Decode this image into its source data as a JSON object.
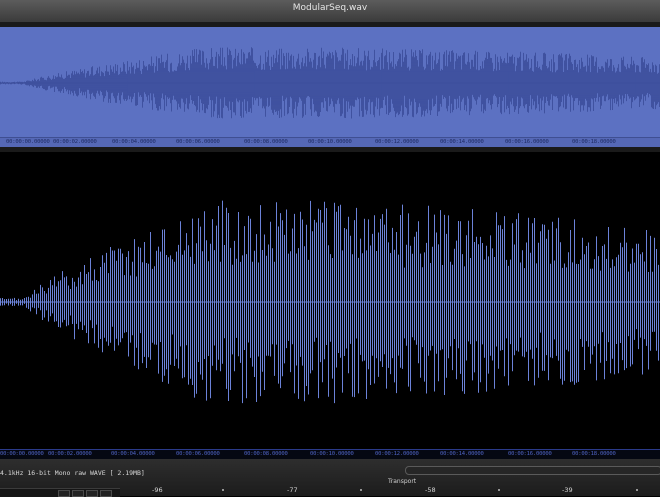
{
  "window": {
    "title": "ModularSeq.wav"
  },
  "timeline": {
    "labels": [
      "00:00:02.00000",
      "00:00:04.00000",
      "00:00:06.00000",
      "00:00:08.00000",
      "00:00:10.00000",
      "00:00:12.00000",
      "00:00:14.00000",
      "00:00:16.00000",
      "00:00:18.00000"
    ],
    "start_label": "00:00:00.00000"
  },
  "status": {
    "file_info": "4.1kHz 16-bit Mono raw  WAVE [ 2.19MB]",
    "transport_label": "Transport",
    "meter_labels": [
      "-96",
      "-77",
      "-58",
      "-39"
    ]
  },
  "colors": {
    "waveform": "#6b82d8",
    "overview_bg": "#5c71c2",
    "overview_wave": "#3d4f9c"
  }
}
